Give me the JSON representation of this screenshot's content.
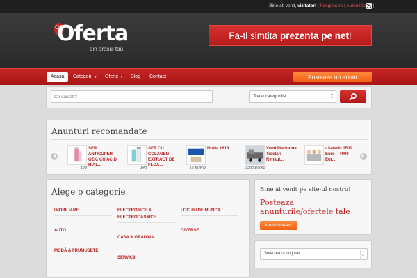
{
  "topbar": {
    "welcome_prefix": "Bine ati venit,",
    "visitor": "vizitator!",
    "sep1": " | ",
    "register": "Inregistrare",
    "sep2": " | ",
    "login": "Autentificare",
    "sep3": " | ",
    "rss_icon": "rss-icon"
  },
  "header": {
    "logo_text": "Oferta",
    "logo_sub": "din orasul tau",
    "banner_prefix": "Fa-ti simtita",
    "banner_bold": "prezenta pe net",
    "banner_suffix": "!"
  },
  "nav": {
    "items": [
      {
        "label": "Acasa"
      },
      {
        "label": "Categorii"
      },
      {
        "label": "Oferte"
      },
      {
        "label": "Blog"
      },
      {
        "label": "Contact"
      }
    ],
    "post_button": "Posteaza un anunt"
  },
  "search": {
    "placeholder": "Ce cautati?",
    "category_selected": "Toate categoriile"
  },
  "recommended": {
    "title": "Anunturi recomandate",
    "items": [
      {
        "name": "SER ANTICUPER OZIC CU ACID HIAL...",
        "price": "109"
      },
      {
        "name": "SER CU COLAGEN EXTRACT DE FLOA...",
        "price": "146"
      },
      {
        "name": "Nokia 1616",
        "price": "19 EURO"
      },
      {
        "name": "Vand Platforma Tractari Renaul...",
        "price": "9300 EURO"
      },
      {
        "name": "- Salariu 1500 Euro – 4000 Eur...",
        "price": ""
      }
    ]
  },
  "categories": {
    "title": "Alege o categorie",
    "col1": [
      "IMOBILIARE",
      "AUTO",
      "MODĂ & FRUMUSETE"
    ],
    "col2": [
      "ELECTRONICE & ELECTROCASNICE",
      "CASA & GRADINA",
      "SERVICII"
    ],
    "col3": [
      "LOCURI DE MUNCA",
      "DIVERSE"
    ]
  },
  "welcome_box": {
    "title": "Bine ai venit pe site-ul nostru!",
    "headline": "Posteaza anunturile/ofertele tale",
    "button": "Inscrie-te acum!"
  },
  "county": {
    "selected": "Selecteaza un judet..."
  },
  "colors": {
    "accent": "#b71b1b",
    "orange": "#f25f12"
  }
}
